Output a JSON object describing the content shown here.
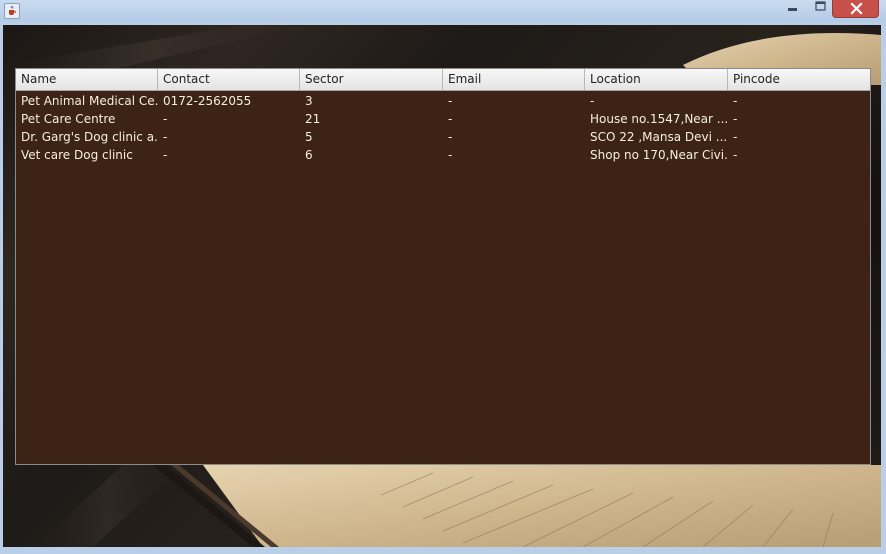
{
  "window": {
    "title": "",
    "icon": "java-cup-icon",
    "controls": {
      "minimize": "minimize-icon",
      "maximize": "maximize-icon",
      "close": "close-icon"
    }
  },
  "table": {
    "columns": [
      "Name",
      "Contact",
      "Sector",
      "Email",
      "Location",
      "Pincode"
    ],
    "rows": [
      [
        "Pet Animal Medical Ce...",
        "0172-2562055",
        "3",
        "-",
        "-",
        "-"
      ],
      [
        "Pet Care Centre",
        "-",
        "21",
        "-",
        "House no.1547,Near ...",
        "-"
      ],
      [
        "Dr. Garg's Dog clinic a...",
        "-",
        "5",
        "-",
        "SCO 22 ,Mansa Devi ...",
        "-"
      ],
      [
        "Vet care Dog clinic",
        "-",
        "6",
        "-",
        "Shop no 170,Near Civi...",
        "-"
      ]
    ]
  },
  "colors": {
    "table_background": "#3d2316",
    "cell_text": "#f6f0d8",
    "header_text": "#222222",
    "close_button": "#c7504a"
  }
}
